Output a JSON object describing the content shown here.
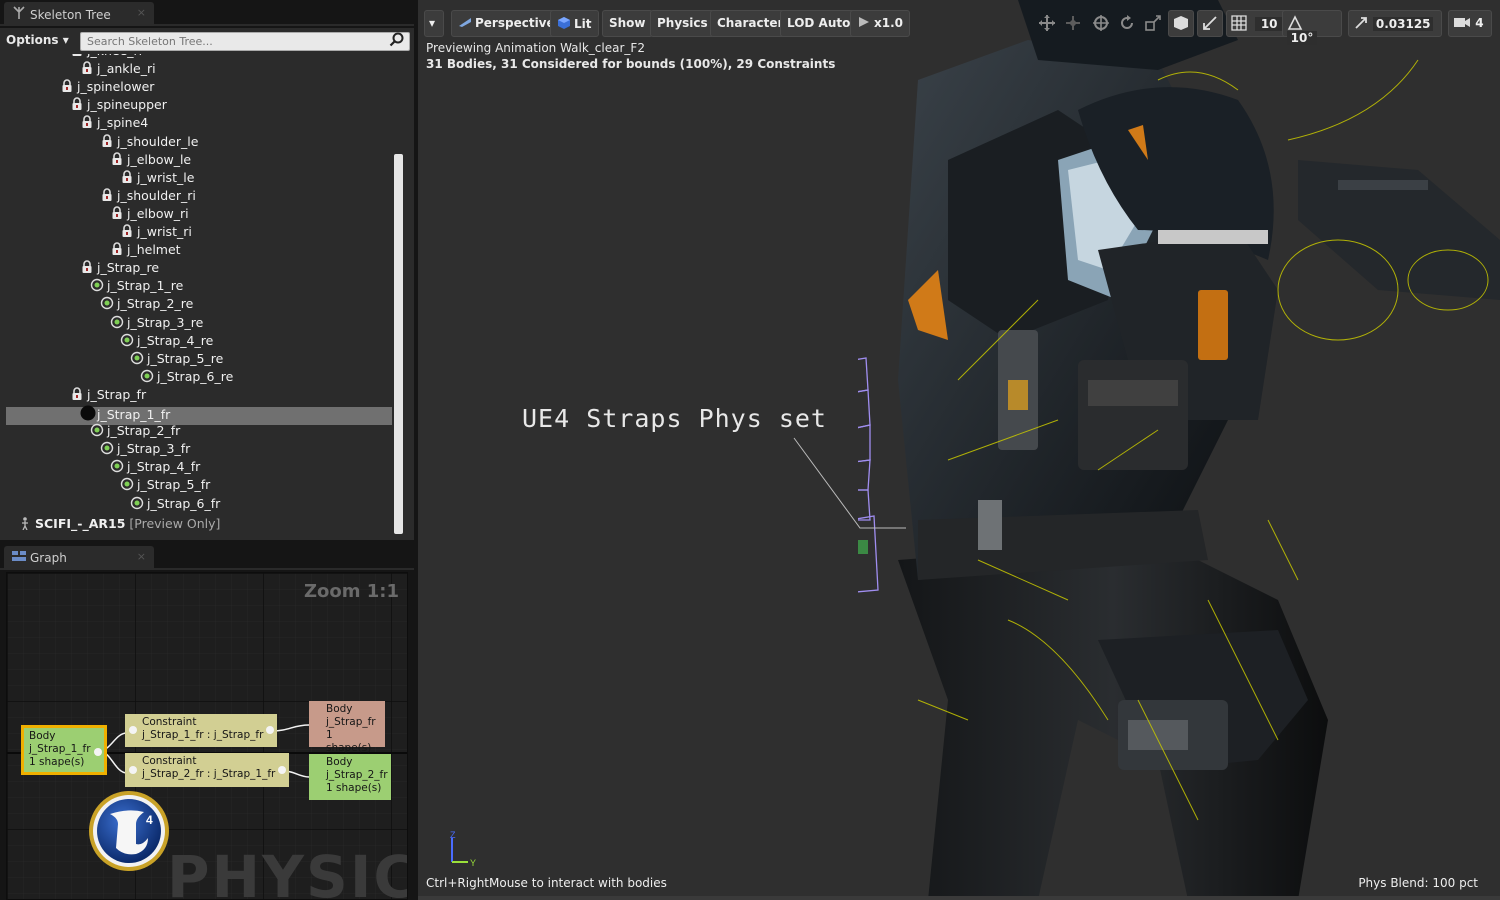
{
  "skeleton_tab": {
    "title": "Skeleton Tree",
    "close": "×"
  },
  "skeleton_toolbar": {
    "options": "Options ▾",
    "search_placeholder": "Search Skeleton Tree..."
  },
  "tree": [
    {
      "label": "j_knee_ri",
      "icon": "lock"
    },
    {
      "label": "j_ankle_ri",
      "icon": "lock"
    },
    {
      "label": "j_spinelower",
      "icon": "lock"
    },
    {
      "label": "j_spineupper",
      "icon": "lock"
    },
    {
      "label": "j_spine4",
      "icon": "lock"
    },
    {
      "label": "j_shoulder_le",
      "icon": "lock"
    },
    {
      "label": "j_elbow_le",
      "icon": "lock"
    },
    {
      "label": "j_wrist_le",
      "icon": "lock"
    },
    {
      "label": "j_shoulder_ri",
      "icon": "lock"
    },
    {
      "label": "j_elbow_ri",
      "icon": "lock"
    },
    {
      "label": "j_wrist_ri",
      "icon": "lock"
    },
    {
      "label": "j_helmet",
      "icon": "lock"
    },
    {
      "label": "j_Strap_re",
      "icon": "lock"
    },
    {
      "label": "j_Strap_1_re",
      "icon": "constraint"
    },
    {
      "label": "j_Strap_2_re",
      "icon": "constraint"
    },
    {
      "label": "j_Strap_3_re",
      "icon": "constraint"
    },
    {
      "label": "j_Strap_4_re",
      "icon": "constraint"
    },
    {
      "label": "j_Strap_5_re",
      "icon": "constraint"
    },
    {
      "label": "j_Strap_6_re",
      "icon": "constraint"
    },
    {
      "label": "j_Strap_fr",
      "icon": "lock"
    },
    {
      "label": "j_Strap_1_fr",
      "icon": "body-selected",
      "selected": true
    },
    {
      "label": "j_Strap_2_fr",
      "icon": "constraint"
    },
    {
      "label": "j_Strap_3_fr",
      "icon": "constraint"
    },
    {
      "label": "j_Strap_4_fr",
      "icon": "constraint"
    },
    {
      "label": "j_Strap_5_fr",
      "icon": "constraint"
    },
    {
      "label": "j_Strap_6_fr",
      "icon": "constraint"
    }
  ],
  "tree_footer": {
    "label": "SCIFI_-_AR15",
    "suffix": "[Preview Only]"
  },
  "graph_tab": {
    "title": "Graph",
    "close": "×"
  },
  "graph": {
    "zoom": "Zoom 1:1",
    "watermark": "PHYSICS",
    "nodes": {
      "body_main": {
        "line1": "Body",
        "line2": "j_Strap_1_fr",
        "line3": "1 shape(s)"
      },
      "constraint_1": {
        "line1": "Constraint",
        "line2": "j_Strap_1_fr : j_Strap_fr"
      },
      "constraint_2": {
        "line1": "Constraint",
        "line2": "j_Strap_2_fr : j_Strap_1_fr"
      },
      "body_parent": {
        "line1": "Body",
        "line2": "j_Strap_fr",
        "line3": "1 shape(s)"
      },
      "body_child": {
        "line1": "Body",
        "line2": "j_Strap_2_fr",
        "line3": "1 shape(s)"
      }
    },
    "colors": {
      "body_main": "#9ccf72",
      "body_main_border": "#f0b000",
      "constraint": "#d2cf93",
      "body_parent": "#c79a8a",
      "body_child": "#9ccf72"
    }
  },
  "logo": {
    "text": "4"
  },
  "viewport": {
    "buttons": {
      "menu": "▾",
      "perspective": "Perspective",
      "lit": "Lit",
      "show": "Show",
      "physics": "Physics",
      "character": "Character",
      "lod": "LOD Auto",
      "speed": "x1.0"
    },
    "snap": {
      "grid": "10",
      "rotation": "10°",
      "scale": "0.03125",
      "camera_speed": "4"
    },
    "info_line1": "Previewing Animation Walk_clear_F2",
    "info_line2": "31 Bodies, 31 Considered for bounds (100%), 29 Constraints",
    "caption": "UE4 Straps Phys set",
    "hint": "Ctrl+RightMouse to interact with bodies",
    "blend": "Phys Blend: 100 pct",
    "axis": {
      "z": "Z",
      "y": "Y"
    }
  }
}
